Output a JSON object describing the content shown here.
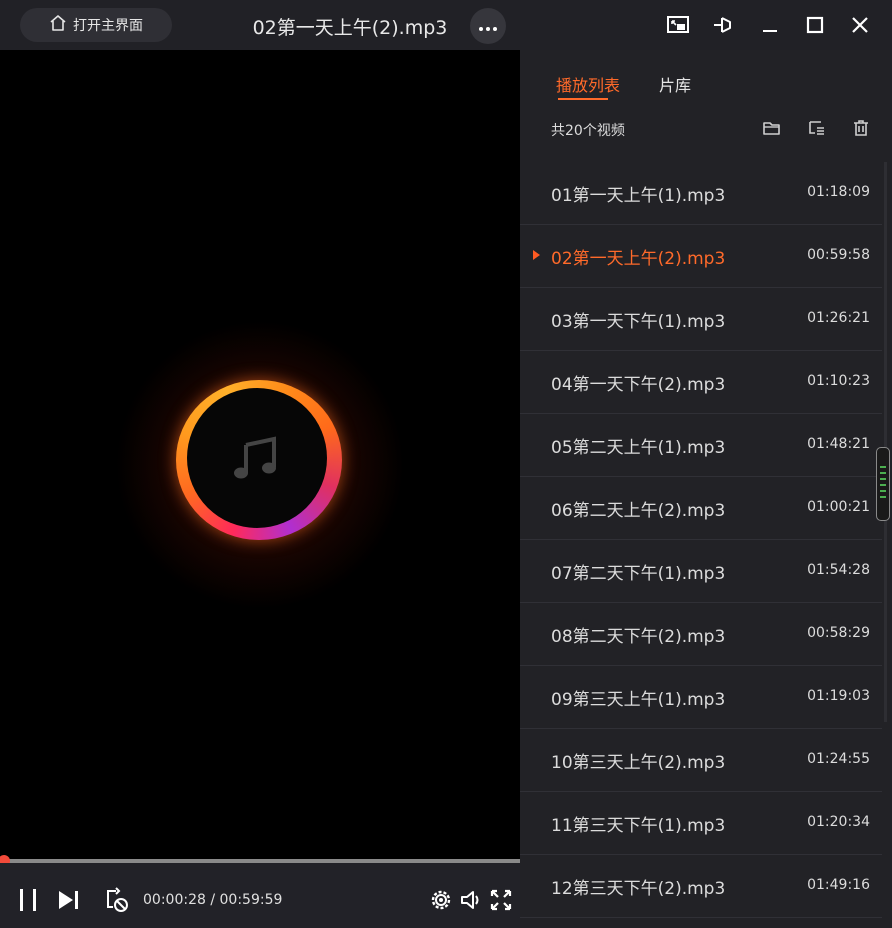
{
  "titlebar": {
    "home_label": "打开主界面",
    "title": "02第一天上午(2).mp3",
    "icons": [
      "home-icon",
      "more-icon",
      "mini-mode-icon",
      "pin-icon",
      "minimize-icon",
      "maximize-icon",
      "close-icon"
    ]
  },
  "player": {
    "current_time": "00:00:28",
    "separator": "/",
    "total_time": "00:59:59",
    "progress": 0.008,
    "center_icon": "music-note-icon",
    "colors": {
      "accent": "#ff6a2a",
      "progress": "#e8472e",
      "bg": "#000000"
    }
  },
  "panel": {
    "tabs": [
      {
        "label": "播放列表",
        "active": true
      },
      {
        "label": "片库",
        "active": false
      }
    ],
    "count_label": "共20个视频",
    "tool_icons": [
      "open-folder-icon",
      "sort-icon",
      "trash-icon"
    ],
    "items": [
      {
        "name": "01第一天上午(1).mp3",
        "duration": "01:18:09"
      },
      {
        "name": "02第一天上午(2).mp3",
        "duration": "00:59:58"
      },
      {
        "name": "03第一天下午(1).mp3",
        "duration": "01:26:21"
      },
      {
        "name": "04第一天下午(2).mp3",
        "duration": "01:10:23"
      },
      {
        "name": "05第二天上午(1).mp3",
        "duration": "01:48:21"
      },
      {
        "name": "06第二天上午(2).mp3",
        "duration": "01:00:21"
      },
      {
        "name": "07第二天下午(1).mp3",
        "duration": "01:54:28"
      },
      {
        "name": "08第二天下午(2).mp3",
        "duration": "00:58:29"
      },
      {
        "name": "09第三天上午(1).mp3",
        "duration": "01:19:03"
      },
      {
        "name": "10第三天上午(2).mp3",
        "duration": "01:24:55"
      },
      {
        "name": "11第三天下午(1).mp3",
        "duration": "01:20:34"
      },
      {
        "name": "12第三天下午(2).mp3",
        "duration": "01:49:16"
      }
    ],
    "active_index": 1
  }
}
